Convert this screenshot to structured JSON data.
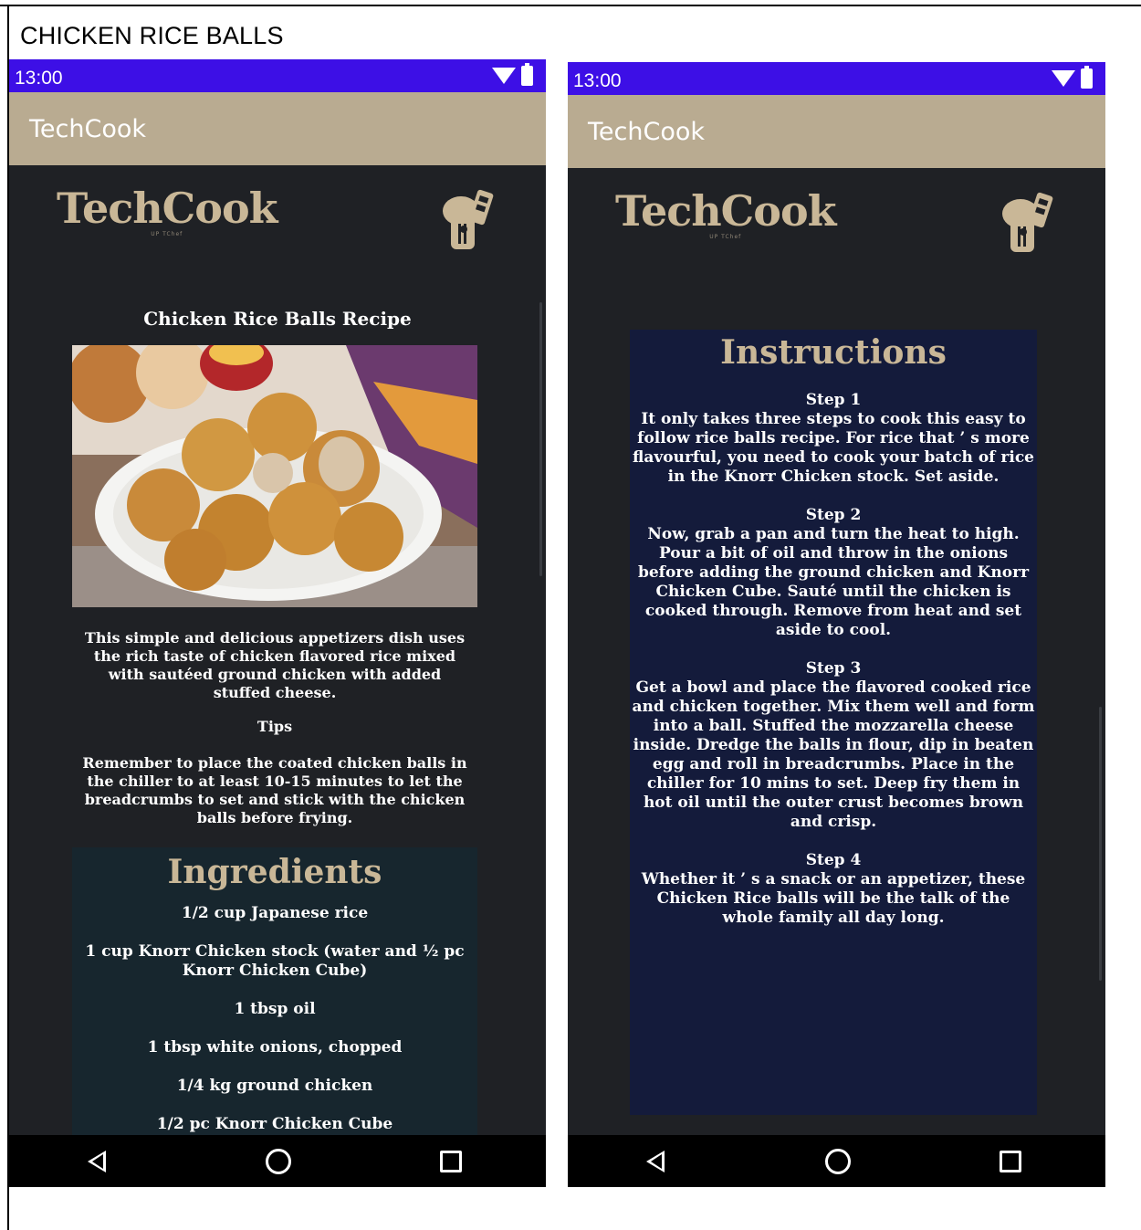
{
  "page_title": "CHICKEN RICE BALLS",
  "left_screen": {
    "status_time": "13:00",
    "app_title": "TechCook",
    "logo_text": "TechCook",
    "logo_sub": "UP TChef",
    "recipe_title": "Chicken Rice Balls Recipe",
    "description": "This simple and delicious appetizers dish uses the rich taste of chicken flavored rice mixed with sautéed ground chicken with added stuffed cheese.",
    "tips_label": "Tips",
    "tips_text": "Remember to place the coated chicken balls in the chiller to at least 10-15 minutes to let the breadcrumbs to set and stick with the chicken balls before frying.",
    "ingredients_heading": "Ingredients",
    "ingredients": [
      "1/2 cup Japanese rice",
      "1 cup Knorr Chicken stock (water and ½ pc Knorr Chicken Cube)",
      "1 tbsp oil",
      "1 tbsp white onions, chopped",
      "1/4 kg ground chicken",
      "1/2 pc Knorr Chicken Cube"
    ]
  },
  "right_screen": {
    "status_time": "13:00",
    "app_title": "TechCook",
    "logo_text": "TechCook",
    "logo_sub": "UP TChef",
    "instructions_heading": "Instructions",
    "steps": [
      {
        "label": "Step 1",
        "text": "It only takes three steps to cook this easy to follow rice balls recipe. For rice that ’ s more flavourful, you need to cook your batch of rice in the Knorr Chicken stock. Set aside."
      },
      {
        "label": "Step 2",
        "text": "Now, grab a pan and turn the heat to high. Pour a bit of oil and throw in the onions before adding the ground chicken and Knorr Chicken Cube. Sauté until the chicken is cooked through. Remove from heat and set aside to cool."
      },
      {
        "label": "Step 3",
        "text": "Get a bowl and place the flavored cooked rice and chicken together. Mix them well and form into a ball. Stuffed the mozzarella cheese inside. Dredge the balls in flour, dip in beaten egg and roll in breadcrumbs. Place in the chiller for 10 mins to set. Deep fry them in hot oil until the outer crust becomes brown and crisp."
      },
      {
        "label": "Step 4",
        "text": "Whether it ’ s a snack or an appetizer, these Chicken Rice balls will be the talk of the whole family all day long."
      }
    ]
  },
  "colors": {
    "status_bar": "#3d0fe6",
    "app_bar": "#b9ab91",
    "background": "#1f2125",
    "accent_gold": "#c9b797",
    "ingredients_bg": "#17262e",
    "instructions_bg": "#141b3b"
  },
  "icons": [
    "wifi-icon",
    "battery-icon",
    "chef-hat-utensils-icon",
    "nav-back-icon",
    "nav-home-icon",
    "nav-recent-icon"
  ]
}
